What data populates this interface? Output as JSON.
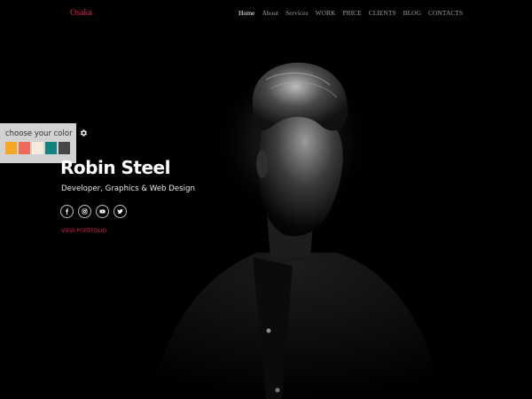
{
  "header": {
    "logo": "Osaka",
    "nav": [
      "Home",
      "About",
      "Services",
      "WORK",
      "PRICE",
      "CLIENTS",
      "BLOG",
      "CONTACTS"
    ],
    "active_item": "Home"
  },
  "color_switcher": {
    "title": "choose your color",
    "swatches": [
      "#f5a623",
      "#f06a5a",
      "#f8eadb",
      "#14837f",
      "#474747"
    ]
  },
  "hero": {
    "name": "Robin Steel",
    "subtitle": "Developer, Graphics & Web Design",
    "social_icons": [
      "facebook-icon",
      "instagram-icon",
      "youtube-icon",
      "twitter-icon"
    ],
    "cta": "VIEW PORTFOLIO"
  },
  "colors": {
    "accent": "#d81b4f",
    "background": "#000000"
  }
}
